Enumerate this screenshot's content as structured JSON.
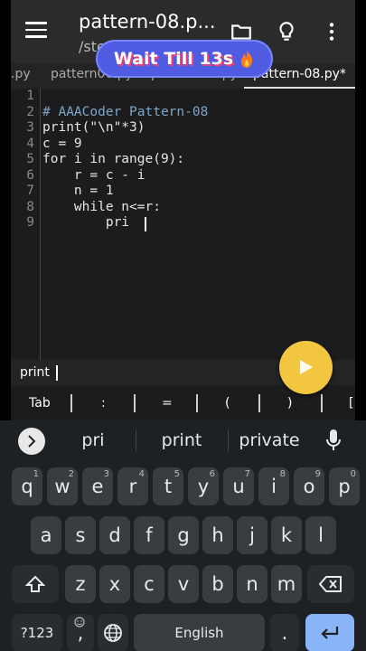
{
  "appbar": {
    "title": "pattern-08.p...",
    "subtitle": "/ste",
    "icons": [
      "menu-icon",
      "folder-icon",
      "lightbulb-icon",
      "more-vert-icon"
    ]
  },
  "tabs": [
    {
      "label": ".py"
    },
    {
      "label": "pattern06.py"
    },
    {
      "label": "pattern-07.py"
    },
    {
      "label": "pattern-08.py*"
    }
  ],
  "badge": {
    "text": "Wait Till 13s",
    "icon": "fire-icon"
  },
  "editor": {
    "line_numbers": [
      "1",
      "2",
      "3",
      "4",
      "5",
      "6",
      "7",
      "8",
      "9"
    ],
    "lines": [
      "",
      "# AAACoder Pattern-08",
      "print(\"\\n\"*3)",
      "c = 9",
      "for i in range(9):",
      "    r = c - i",
      "    n = 1",
      "    while n<=r:",
      "        pri"
    ]
  },
  "suggestion": {
    "text": "print"
  },
  "symbols": [
    "Tab",
    ":",
    "=",
    "(",
    ")",
    "["
  ],
  "colors": {
    "accent_play": "#f2c63f",
    "badge_bg": "#4f5be0",
    "enter_key": "#8ab4f8"
  },
  "keyboard": {
    "predictions": [
      "pri",
      "print",
      "private"
    ],
    "row1": [
      {
        "k": "q",
        "alt": "1"
      },
      {
        "k": "w",
        "alt": "2"
      },
      {
        "k": "e",
        "alt": "3"
      },
      {
        "k": "r",
        "alt": "4"
      },
      {
        "k": "t",
        "alt": "5"
      },
      {
        "k": "y",
        "alt": "6"
      },
      {
        "k": "u",
        "alt": "7"
      },
      {
        "k": "i",
        "alt": "8"
      },
      {
        "k": "o",
        "alt": "9"
      },
      {
        "k": "p",
        "alt": "0"
      }
    ],
    "row2": [
      "a",
      "s",
      "d",
      "f",
      "g",
      "h",
      "j",
      "k",
      "l"
    ],
    "row3": [
      "z",
      "x",
      "c",
      "v",
      "b",
      "n",
      "m"
    ],
    "symbols_key": "?123",
    "comma": ",",
    "space": "English",
    "period": "."
  }
}
